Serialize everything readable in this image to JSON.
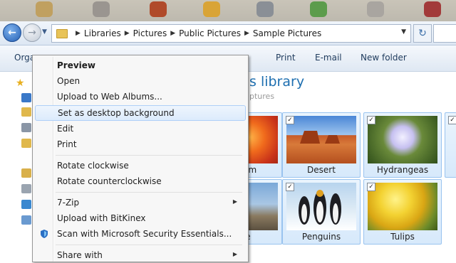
{
  "address_bar": {
    "crumbs": [
      "Libraries",
      "Pictures",
      "Public Pictures",
      "Sample Pictures"
    ]
  },
  "toolbar": {
    "organize_label": "Orga",
    "print_label": "Print",
    "email_label": "E-mail",
    "new_folder_label": "New folder"
  },
  "library": {
    "title_visible": "s library",
    "subtitle_visible": "ptures"
  },
  "tiles": [
    {
      "name": "emum",
      "image": "chrysanthemum"
    },
    {
      "name": "Desert",
      "image": "desert"
    },
    {
      "name": "Hydrangeas",
      "image": "hydrangeas"
    },
    {
      "name": "use",
      "image": "lighthouse"
    },
    {
      "name": "Penguins",
      "image": "penguins"
    },
    {
      "name": "Tulips",
      "image": "tulips"
    }
  ],
  "context_menu": {
    "items": [
      {
        "label": "Preview",
        "bold": true
      },
      {
        "label": "Open"
      },
      {
        "label": "Upload to Web Albums..."
      },
      {
        "label": "Set as desktop background",
        "highlighted": true
      },
      {
        "label": "Edit"
      },
      {
        "label": "Print"
      },
      {
        "label": "Rotate clockwise"
      },
      {
        "label": "Rotate counterclockwise"
      },
      {
        "label": "7-Zip",
        "submenu": true
      },
      {
        "label": "Upload with BitKinex"
      },
      {
        "label": "Scan with Microsoft Security Essentials...",
        "icon": "security-essentials-icon"
      },
      {
        "label": "Share with",
        "submenu": true
      }
    ]
  },
  "colors": {
    "accent_blue": "#1e6fb0",
    "selection_border": "#99c3ef",
    "menu_highlight": "#dcebfc"
  }
}
